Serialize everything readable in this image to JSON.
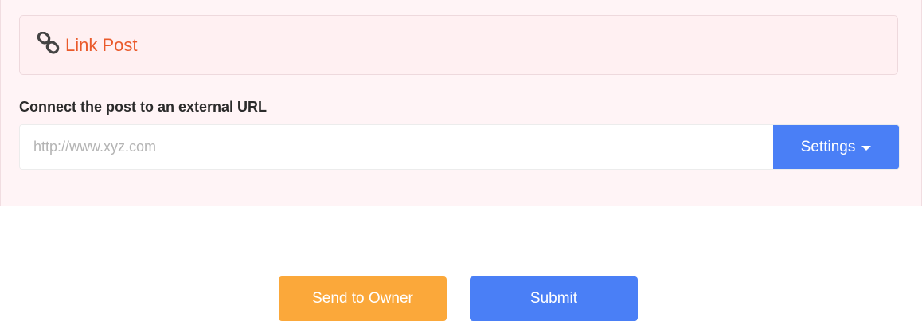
{
  "link_post": {
    "icon": "link-icon",
    "title": "Link Post",
    "title_color": "#ea5a2b",
    "section_label": "Connect the post to an external URL",
    "url_input": {
      "value": "",
      "placeholder": "http://www.xyz.com"
    },
    "settings_label": "Settings"
  },
  "actions": {
    "send_to_owner_label": "Send to Owner",
    "submit_label": "Submit"
  },
  "colors": {
    "primary": "#4a7ff6",
    "warning": "#fba83a",
    "panel_bg": "#fff4f6"
  }
}
